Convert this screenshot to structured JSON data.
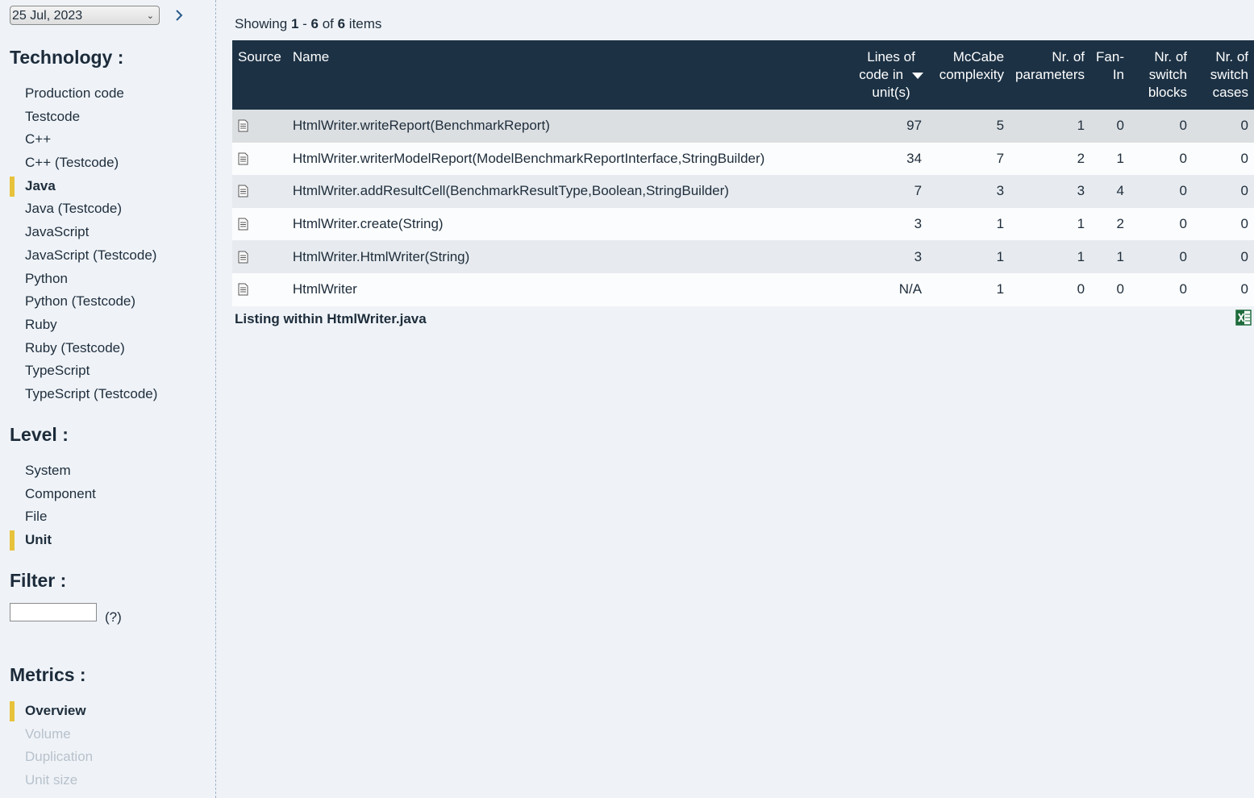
{
  "sidebar": {
    "date": "25 Jul, 2023",
    "next_icon": "chevron-right-icon",
    "technology": {
      "title": "Technology :",
      "items": [
        {
          "label": "Production code",
          "active": false
        },
        {
          "label": "Testcode",
          "active": false
        },
        {
          "label": "C++",
          "active": false
        },
        {
          "label": "C++ (Testcode)",
          "active": false
        },
        {
          "label": "Java",
          "active": true
        },
        {
          "label": "Java (Testcode)",
          "active": false
        },
        {
          "label": "JavaScript",
          "active": false
        },
        {
          "label": "JavaScript (Testcode)",
          "active": false
        },
        {
          "label": "Python",
          "active": false
        },
        {
          "label": "Python (Testcode)",
          "active": false
        },
        {
          "label": "Ruby",
          "active": false
        },
        {
          "label": "Ruby (Testcode)",
          "active": false
        },
        {
          "label": "TypeScript",
          "active": false
        },
        {
          "label": "TypeScript (Testcode)",
          "active": false
        }
      ]
    },
    "level": {
      "title": "Level :",
      "items": [
        {
          "label": "System",
          "active": false
        },
        {
          "label": "Component",
          "active": false
        },
        {
          "label": "File",
          "active": false
        },
        {
          "label": "Unit",
          "active": true
        }
      ]
    },
    "filter": {
      "title": "Filter :",
      "value": "",
      "help": "(?)"
    },
    "metrics": {
      "title": "Metrics :",
      "items": [
        {
          "label": "Overview",
          "active": true,
          "disabled": false
        },
        {
          "label": "Volume",
          "active": false,
          "disabled": true
        },
        {
          "label": "Duplication",
          "active": false,
          "disabled": true
        },
        {
          "label": "Unit size",
          "active": false,
          "disabled": true
        }
      ]
    }
  },
  "main": {
    "showing": {
      "prefix": "Showing ",
      "from": "1",
      "sep": " - ",
      "to": "6",
      "of": " of ",
      "total": "6",
      "suffix": " items"
    },
    "table": {
      "columns": [
        {
          "key": "source",
          "label": "Source"
        },
        {
          "key": "name",
          "label": "Name"
        },
        {
          "key": "loc",
          "label": "Lines of code in unit(s)"
        },
        {
          "key": "mccabe",
          "label": "McCabe complexity"
        },
        {
          "key": "params",
          "label": "Nr. of parameters"
        },
        {
          "key": "fanin",
          "label": "Fan-In"
        },
        {
          "key": "switch_blocks",
          "label": "Nr. of switch blocks"
        },
        {
          "key": "switch_cases",
          "label": "Nr. of switch cases"
        }
      ],
      "sorted_column": "loc",
      "sort_direction": "descending",
      "rows": [
        {
          "name": "HtmlWriter.writeReport(BenchmarkReport)",
          "loc": "97",
          "mccabe": "5",
          "params": "1",
          "fanin": "0",
          "switch_blocks": "0",
          "switch_cases": "0"
        },
        {
          "name": "HtmlWriter.writerModelReport(ModelBenchmarkReportInterface,StringBuilder)",
          "loc": "34",
          "mccabe": "7",
          "params": "2",
          "fanin": "1",
          "switch_blocks": "0",
          "switch_cases": "0"
        },
        {
          "name": "HtmlWriter.addResultCell(BenchmarkResultType,Boolean,StringBuilder)",
          "loc": "7",
          "mccabe": "3",
          "params": "3",
          "fanin": "4",
          "switch_blocks": "0",
          "switch_cases": "0"
        },
        {
          "name": "HtmlWriter.create(String)",
          "loc": "3",
          "mccabe": "1",
          "params": "1",
          "fanin": "2",
          "switch_blocks": "0",
          "switch_cases": "0"
        },
        {
          "name": "HtmlWriter.HtmlWriter(String)",
          "loc": "3",
          "mccabe": "1",
          "params": "1",
          "fanin": "1",
          "switch_blocks": "0",
          "switch_cases": "0"
        },
        {
          "name": "HtmlWriter",
          "loc": "N/A",
          "mccabe": "1",
          "params": "0",
          "fanin": "0",
          "switch_blocks": "0",
          "switch_cases": "0"
        }
      ]
    },
    "listing": "Listing within HtmlWriter.java",
    "export_icon": "excel-export-icon",
    "colors": {
      "header_bg": "#1c3144",
      "accent": "#e7c23b",
      "page_bg": "#eff3f8"
    }
  }
}
